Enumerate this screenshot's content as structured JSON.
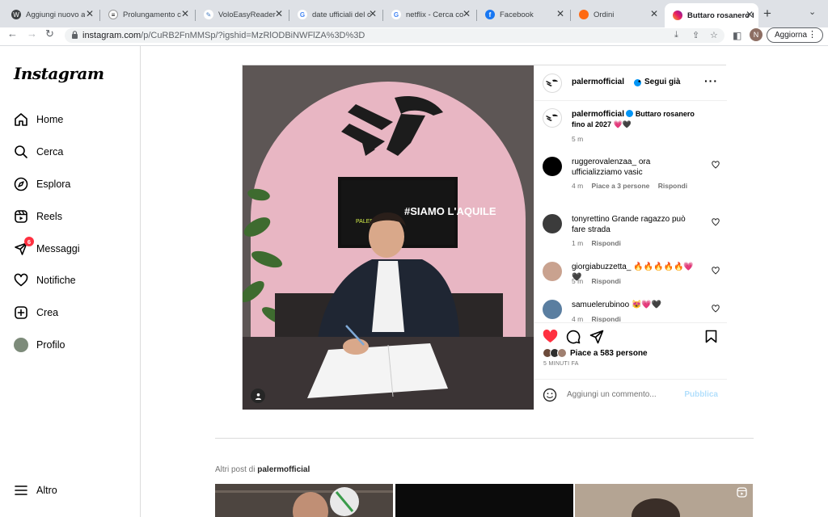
{
  "browser": {
    "tabs": [
      {
        "title": "Aggiungi nuovo a",
        "icon": "wordpress-icon"
      },
      {
        "title": "Prolungamento c",
        "icon": "palermo-logo-icon"
      },
      {
        "title": "VoloEasyReader",
        "icon": "feather-icon"
      },
      {
        "title": "date ufficiali del c",
        "icon": "google-icon"
      },
      {
        "title": "netflix - Cerca co",
        "icon": "google-icon"
      },
      {
        "title": "Facebook",
        "icon": "facebook-icon"
      },
      {
        "title": "Ordini",
        "icon": "flame-icon"
      },
      {
        "title": "Buttaro rosanero fi",
        "icon": "instagram-icon",
        "active": true
      }
    ],
    "url_host": "instagram.com",
    "url_path": "/p/CuRB2FnMMSp/?igshid=MzRlODBiNWFlZA%3D%3D",
    "update_label": "Aggiorna",
    "profile_initial": "N"
  },
  "sidebar": {
    "logo": "Instagram",
    "items": [
      {
        "label": "Home",
        "icon": "home-icon"
      },
      {
        "label": "Cerca",
        "icon": "search-icon"
      },
      {
        "label": "Esplora",
        "icon": "compass-icon"
      },
      {
        "label": "Reels",
        "icon": "reels-icon"
      },
      {
        "label": "Messaggi",
        "icon": "messenger-icon",
        "badge": "6"
      },
      {
        "label": "Notifiche",
        "icon": "heart-icon"
      },
      {
        "label": "Crea",
        "icon": "plus-square-icon"
      },
      {
        "label": "Profilo",
        "icon": "profile-avatar"
      }
    ],
    "more_label": "Altro"
  },
  "post": {
    "author": "palermofficial",
    "follow_status": "Segui già",
    "caption": "Buttaro rosanero fino al 2027 💗🖤",
    "caption_time": "5 m",
    "photo_screen_text": "#SIAMO L'AQUILE",
    "comments": [
      {
        "user": "ruggerovalenzaa_",
        "text": "ora ufficializziamo vasic",
        "time": "4 m",
        "likes": "Piace a 3 persone",
        "reply": "Rispondi",
        "avatar_color": "#000000"
      },
      {
        "user": "tonyrettino",
        "text": "Grande ragazzo può fare strada",
        "time": "1 m",
        "likes": "",
        "reply": "Rispondi",
        "avatar_color": "#3b3b3b"
      },
      {
        "user": "giorgiabuzzetta_",
        "text": "🔥🔥🔥🔥🔥💗🖤",
        "time": "5 m",
        "likes": "",
        "reply": "Rispondi",
        "avatar_color": "#c9a28f"
      },
      {
        "user": "samuelerubinoo",
        "text": "😻💗🖤",
        "time": "4 m",
        "likes": "",
        "reply": "Rispondi",
        "avatar_color": "#5a7ea0"
      }
    ],
    "likes_text": "Piace a 583 persone",
    "posted_ago": "5 MINUTI FA",
    "comment_placeholder": "Aggiungi un commento...",
    "publish_label": "Pubblica"
  },
  "more_posts": {
    "prefix": "Altri post di",
    "author": "palermofficial"
  },
  "colors": {
    "like_red": "#ff3040",
    "link_blue": "#0095f6",
    "wall_pink": "#e8b6c3"
  }
}
